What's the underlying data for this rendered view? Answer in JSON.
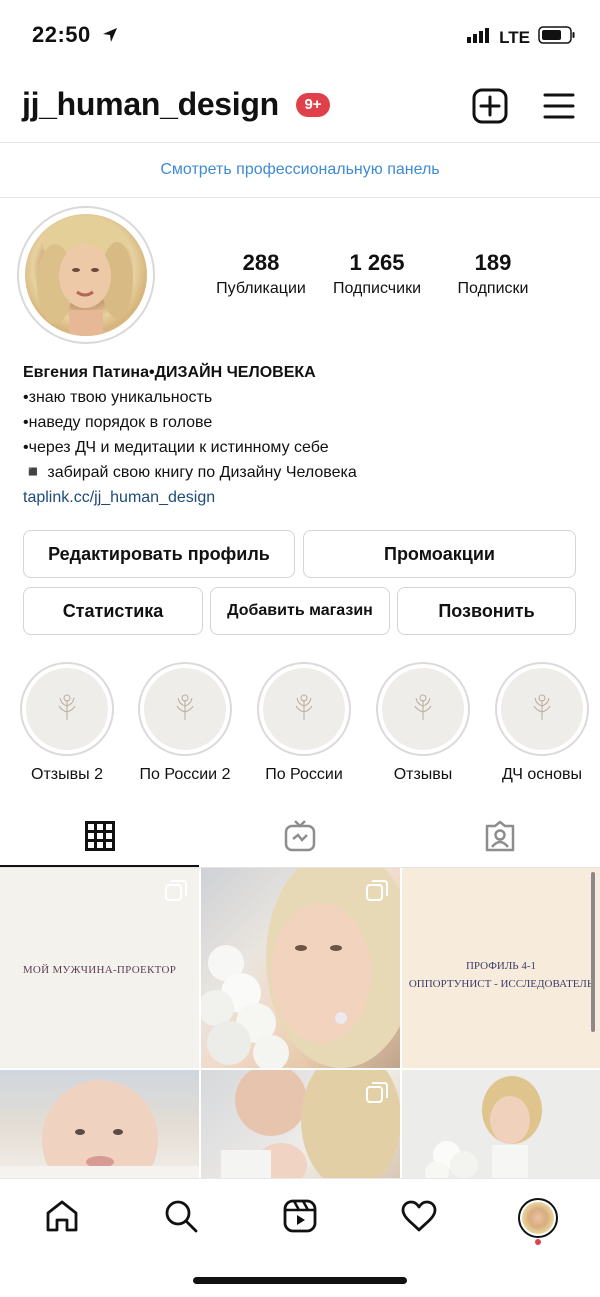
{
  "status_bar": {
    "time": "22:50",
    "network": "LTE"
  },
  "header": {
    "username": "jj_human_design",
    "notifications_badge": "9+"
  },
  "pro_panel": {
    "label": "Смотреть профессиональную панель"
  },
  "stats": [
    {
      "value": "288",
      "label": "Публикации"
    },
    {
      "value": "1 265",
      "label": "Подписчики"
    },
    {
      "value": "189",
      "label": "Подписки"
    }
  ],
  "bio": {
    "name": "Евгения Патина•ДИЗАЙН ЧЕЛОВЕКА",
    "lines": [
      "•знаю твою уникальность",
      "•наведу порядок в голове",
      "•через ДЧ и медитации к истинному себе",
      "◾️ забирай свою книгу по Дизайну Человека"
    ],
    "link": "taplink.cc/jj_human_design"
  },
  "buttons": {
    "edit_profile": "Редактировать профиль",
    "promotions": "Промоакции",
    "insights": "Статистика",
    "add_shop": "Добавить магазин",
    "call": "Позвонить"
  },
  "highlights": [
    {
      "label": "Отзывы 2"
    },
    {
      "label": "По России 2"
    },
    {
      "label": "По России"
    },
    {
      "label": "Отзывы"
    },
    {
      "label": "ДЧ основы"
    }
  ],
  "tabs": [
    "grid-icon",
    "igtv-icon",
    "tagged-icon"
  ],
  "posts": [
    {
      "caption": "МОЙ МУЖЧИНА-ПРОЕКТОР"
    },
    {
      "caption": ""
    },
    {
      "caption_line1": "ПРОФИЛЬ 4-1",
      "caption_line2": "ОППОРТУНИСТ - ИССЛЕДОВАТЕЛЬ"
    }
  ],
  "colors": {
    "accent_link": "#3d8bd6",
    "badge": "#e0404a",
    "bio_link": "#1e4a7a"
  },
  "bottom_nav": [
    "home-icon",
    "search-icon",
    "reels-icon",
    "heart-icon",
    "profile-avatar"
  ]
}
